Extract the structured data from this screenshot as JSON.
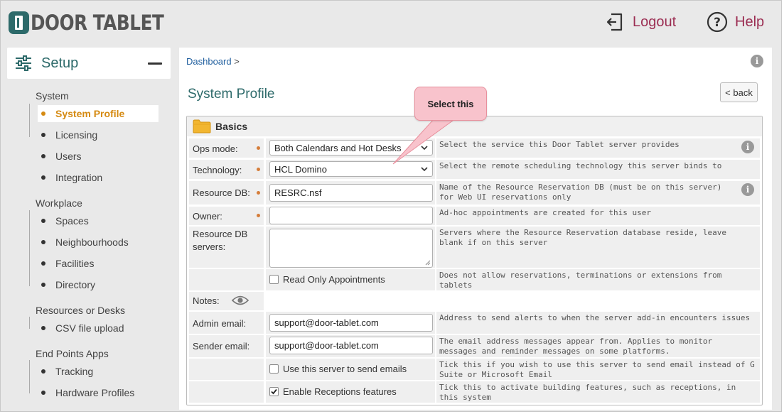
{
  "app": {
    "logo_text": "DOOR TABLET",
    "logout_label": "Logout",
    "help_label": "Help"
  },
  "sidebar": {
    "title": "Setup",
    "sections": [
      {
        "title": "System",
        "items": [
          "System Profile",
          "Licensing",
          "Users",
          "Integration"
        ]
      },
      {
        "title": "Workplace",
        "items": [
          "Spaces",
          "Neighbourhoods",
          "Facilities",
          "Directory"
        ]
      },
      {
        "title": "Resources or Desks",
        "items": [
          "CSV file upload"
        ]
      },
      {
        "title": "End Points Apps",
        "items": [
          "Tracking",
          "Hardware Profiles"
        ]
      }
    ],
    "active_item": "System Profile"
  },
  "main": {
    "breadcrumb": {
      "link": "Dashboard",
      "sep": ">"
    },
    "title": "System Profile",
    "back_label": "< back",
    "section": {
      "title": "Basics",
      "fields": {
        "ops_mode": {
          "label": "Ops mode:",
          "value": "Both Calendars and Hot Desks",
          "desc": "Select the service this Door Tablet server provides"
        },
        "technology": {
          "label": "Technology:",
          "value": "HCL Domino",
          "desc": "Select the remote scheduling technology this server binds to"
        },
        "resource_db": {
          "label": "Resource DB:",
          "value": "RESRC.nsf",
          "desc": "Name of the Resource Reservation DB (must be on this server) for Web UI reservations only"
        },
        "owner": {
          "label": "Owner:",
          "value": "",
          "desc": "Ad-hoc appointments are created for this user"
        },
        "resource_db_servers": {
          "label": "Resource DB servers:",
          "value": "",
          "desc": "Servers where the Resource Reservation database reside, leave blank if on this server"
        },
        "read_only": {
          "label": "Read Only Appointments",
          "checked": false,
          "desc": "Does not allow reservations, terminations or extensions from tablets"
        },
        "notes": {
          "label": "Notes:"
        },
        "admin_email": {
          "label": "Admin email:",
          "value": "support@door-tablet.com",
          "desc": "Address to send alerts to when the server add-in encounters issues"
        },
        "sender_email": {
          "label": "Sender email:",
          "value": "support@door-tablet.com",
          "desc": "The email address messages appear from. Applies to monitor messages and reminder messages on some platforms."
        },
        "send_emails": {
          "label": "Use this server to send emails",
          "checked": false,
          "desc": "Tick this if you wish to use this server to send email instead of G Suite or Microsoft Email"
        },
        "receptions": {
          "label": "Enable Receptions features",
          "checked": true,
          "desc": "Tick this to activate building features, such as receptions, in this system"
        }
      }
    }
  },
  "callout": {
    "text": "Select this"
  },
  "colors": {
    "brand": "#2d6a6a",
    "accent": "#9b2d52",
    "active": "#d58a12",
    "callout": "#f8c3cc"
  }
}
